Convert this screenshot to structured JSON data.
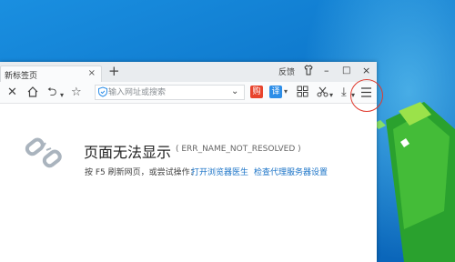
{
  "browser": {
    "tab": {
      "label": "新标签页",
      "close": "×"
    },
    "new_tab": "+",
    "titlebar": {
      "feedback": "反馈",
      "minimize": "–",
      "maximize": "□",
      "close": "×"
    },
    "toolbar": {
      "stop": "✕",
      "back": "⮌",
      "back_arrow": "▾",
      "star": "☆",
      "address_placeholder": "输入网址或搜索",
      "address_dropdown": "⌄",
      "download": "⤓",
      "badge_gou": "购",
      "badge_yi": "译",
      "badge_arrow": "▾",
      "cut_arrow": "▾",
      "dl_arrow": "▾"
    },
    "error": {
      "title": "页面无法显示",
      "code": "( ERR_NAME_NOT_RESOLVED )",
      "hint": "按 F5 刷新网页，或尝试操作：",
      "link1": "打开浏览器医生",
      "link2": "检查代理服务器设置"
    }
  },
  "colors": {
    "accent": "#1a73c7",
    "badge_gou": "#e8442d",
    "badge_yi": "#2d8ee8",
    "ring": "#e03a2e"
  }
}
